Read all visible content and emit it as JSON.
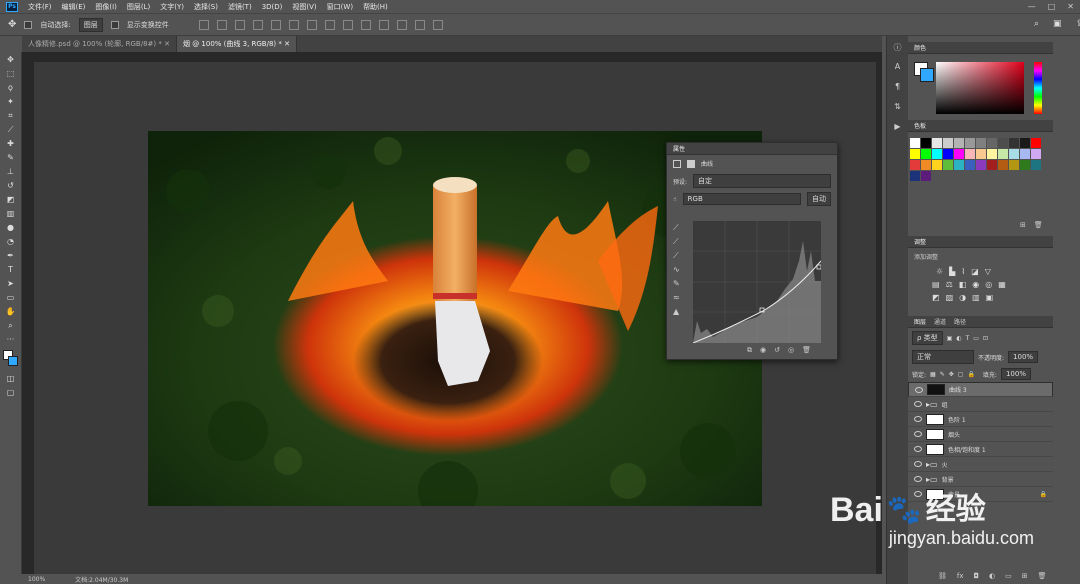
{
  "menubar": {
    "logo": "Ps",
    "items": [
      "文件(F)",
      "编辑(E)",
      "图像(I)",
      "图层(L)",
      "文字(Y)",
      "选择(S)",
      "滤镜(T)",
      "3D(D)",
      "视图(V)",
      "窗口(W)",
      "帮助(H)"
    ],
    "controls": [
      "—",
      "□",
      "✕"
    ]
  },
  "optionsbar": {
    "auto_select_label": "自动选择:",
    "auto_select_value": "图层",
    "transform_label": "显示变换控件"
  },
  "tabs": [
    {
      "label": "人像精修.psd @ 100% (轮廓, RGB/8#) *"
    },
    {
      "label": "烟 @ 100% (曲线 3, RGB/8) *"
    }
  ],
  "status": {
    "zoom": "100%",
    "doc": "文档:2.04M/30.3M"
  },
  "properties": {
    "title": "属性",
    "mode": "曲线",
    "preset_label": "预设:",
    "preset_value": "自定",
    "channel_value": "RGB",
    "auto_label": "自动"
  },
  "panels": {
    "color_tabs": [
      "颜色"
    ],
    "swatches_tabs": [
      "色板"
    ],
    "adjust_tab": "调整",
    "adjust_sub": "添加调整",
    "layers_tabs": [
      "图层",
      "通道",
      "路径"
    ],
    "kind": "ρ 类型",
    "blend": "正常",
    "opacity_label": "不透明度:",
    "opacity": "100%",
    "fill_label": "填充:",
    "fill": "100%",
    "lock_label": "锁定:"
  },
  "layers": [
    {
      "name": "曲线 3",
      "selected": true,
      "thumb": "dark"
    },
    {
      "name": "组",
      "group": true
    },
    {
      "name": "色阶 1",
      "thumb": "white"
    },
    {
      "name": "烟头",
      "thumb": "white"
    },
    {
      "name": "色相/饱和度 1",
      "thumb": "white"
    },
    {
      "name": "火",
      "group": true
    },
    {
      "name": "背景",
      "group": true
    },
    {
      "name": "背景",
      "thumb": "white",
      "locked": true
    }
  ],
  "swatch_colors": [
    "#ffffff",
    "#000000",
    "#e6e6e6",
    "#cccccc",
    "#b3b3b3",
    "#999999",
    "#808080",
    "#666666",
    "#4d4d4d",
    "#333333",
    "#1a1a1a",
    "#ff0000",
    "#ffff00",
    "#00ff00",
    "#00ffff",
    "#0000ff",
    "#ff00ff",
    "#f7b7b7",
    "#f9c990",
    "#fff5a0",
    "#c7e9a8",
    "#a8dde8",
    "#a8b8f0",
    "#d1a8f0",
    "#e33a3a",
    "#f08a24",
    "#ffd21f",
    "#5fbd3a",
    "#2bb3c2",
    "#3a5fbd",
    "#8b3abd",
    "#a31f1f",
    "#b35c12",
    "#b39612",
    "#2f7a1c",
    "#1c7580",
    "#1c337a",
    "#5c1c7a"
  ],
  "accent": "#31a8ff",
  "watermark": {
    "brand": "Bai",
    "brand2": "经验",
    "url": "jingyan.baidu.com"
  }
}
